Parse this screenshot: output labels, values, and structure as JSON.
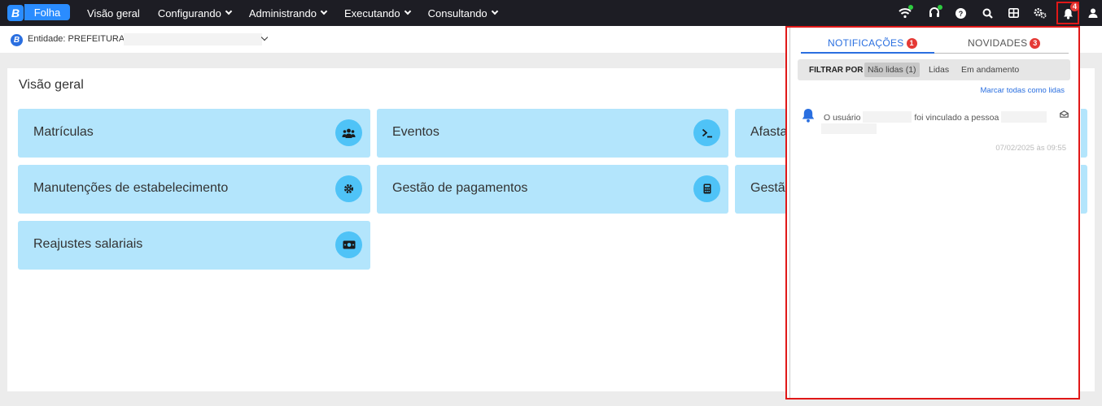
{
  "topbar": {
    "logo_letter": "B",
    "app_name": "Folha",
    "menu": [
      {
        "label": "Visão geral",
        "dropdown": false
      },
      {
        "label": "Configurando",
        "dropdown": true
      },
      {
        "label": "Administrando",
        "dropdown": true
      },
      {
        "label": "Executando",
        "dropdown": true
      },
      {
        "label": "Consultando",
        "dropdown": true
      }
    ],
    "icons": [
      "wifi-icon",
      "headset-icon",
      "help-icon",
      "search-icon",
      "grid-icon",
      "settings-icon",
      "bell-icon",
      "user-icon"
    ],
    "notification_count": "4",
    "status_color": "#2ecc40"
  },
  "entity": {
    "icon_letter": "B",
    "label": "Entidade: PREFEITURA"
  },
  "main": {
    "title": "Visão geral",
    "cards": [
      {
        "label": "Matrículas",
        "icon": "people-icon"
      },
      {
        "label": "Eventos",
        "icon": "terminal-icon"
      },
      {
        "label": "Afasta",
        "icon": ""
      },
      {
        "label": "Manutenções de estabelecimento",
        "icon": "gear-icon"
      },
      {
        "label": "Gestão de pagamentos",
        "icon": "calculator-icon"
      },
      {
        "label": "Gestã",
        "icon": ""
      },
      {
        "label": "Reajustes salariais",
        "icon": "money-icon"
      }
    ],
    "card_color": "#b3e5fc",
    "card_icon_color": "#4fc3f7"
  },
  "notifications": {
    "tabs": [
      {
        "label": "NOTIFICAÇÕES",
        "badge": "1",
        "active": true
      },
      {
        "label": "NOVIDADES",
        "badge": "3",
        "active": false
      }
    ],
    "filter_label": "FILTRAR POR",
    "filters": [
      {
        "label": "Não lidas (1)",
        "selected": true
      },
      {
        "label": "Lidas",
        "selected": false
      },
      {
        "label": "Em andamento",
        "selected": false
      }
    ],
    "mark_all": "Marcar todas como lidas",
    "items": [
      {
        "text_a": "O usuário",
        "text_b": "foi vinculado a pessoa",
        "time": "07/02/2025 às 09:55"
      }
    ],
    "accent": "#2a6fe0",
    "badge_color": "#e53935"
  }
}
